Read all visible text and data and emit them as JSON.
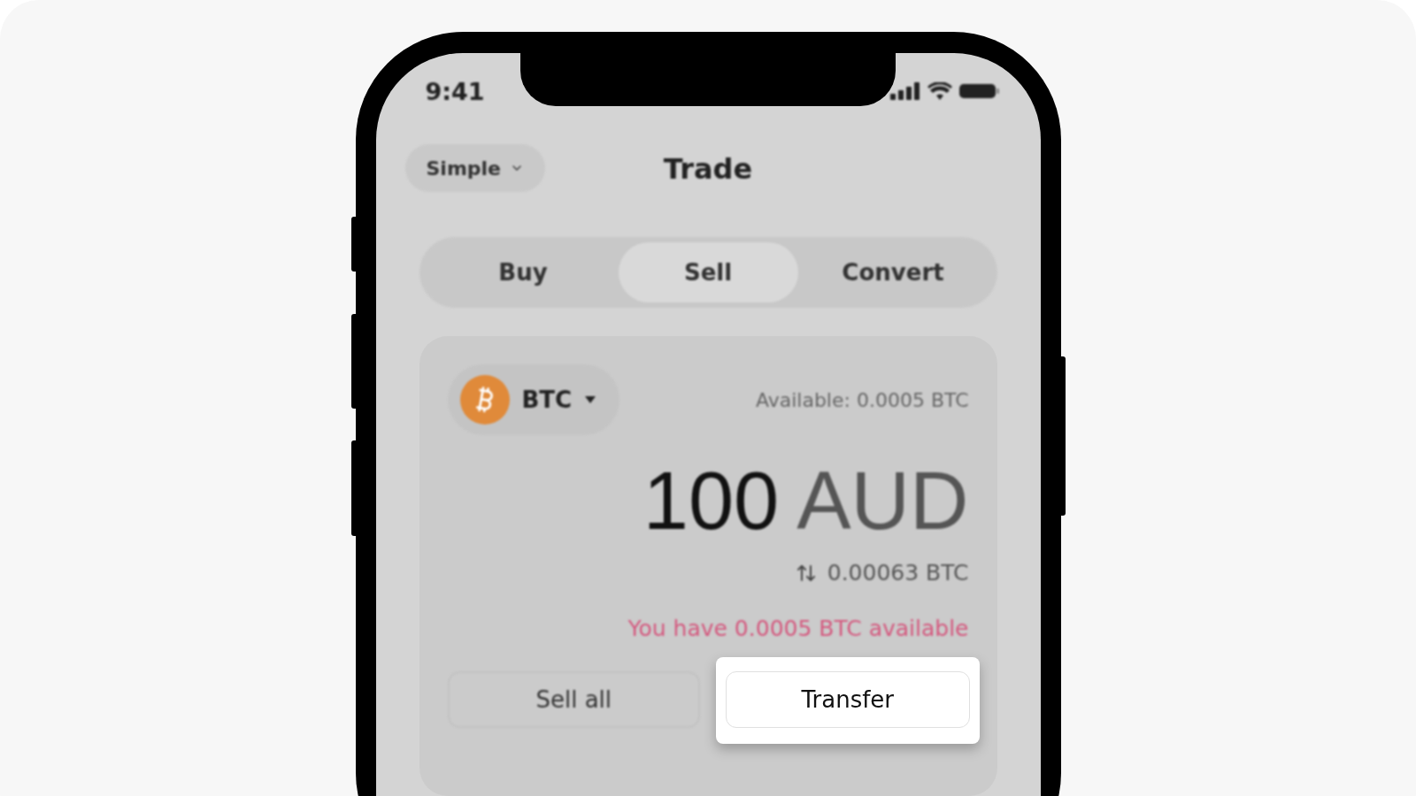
{
  "status_bar": {
    "time": "9:41"
  },
  "header": {
    "mode": "Simple",
    "title": "Trade"
  },
  "tabs": [
    {
      "label": "Buy",
      "selected": false
    },
    {
      "label": "Sell",
      "selected": true
    },
    {
      "label": "Convert",
      "selected": false
    }
  ],
  "card": {
    "asset": "BTC",
    "available": "Available: 0.0005 BTC",
    "amount": "100",
    "currency": "AUD",
    "converted": "0.00063 BTC",
    "warning": "You have 0.0005 BTC available",
    "buttons": [
      {
        "label": "Sell all",
        "highlighted": false
      },
      {
        "label": "Transfer",
        "highlighted": true
      }
    ]
  }
}
